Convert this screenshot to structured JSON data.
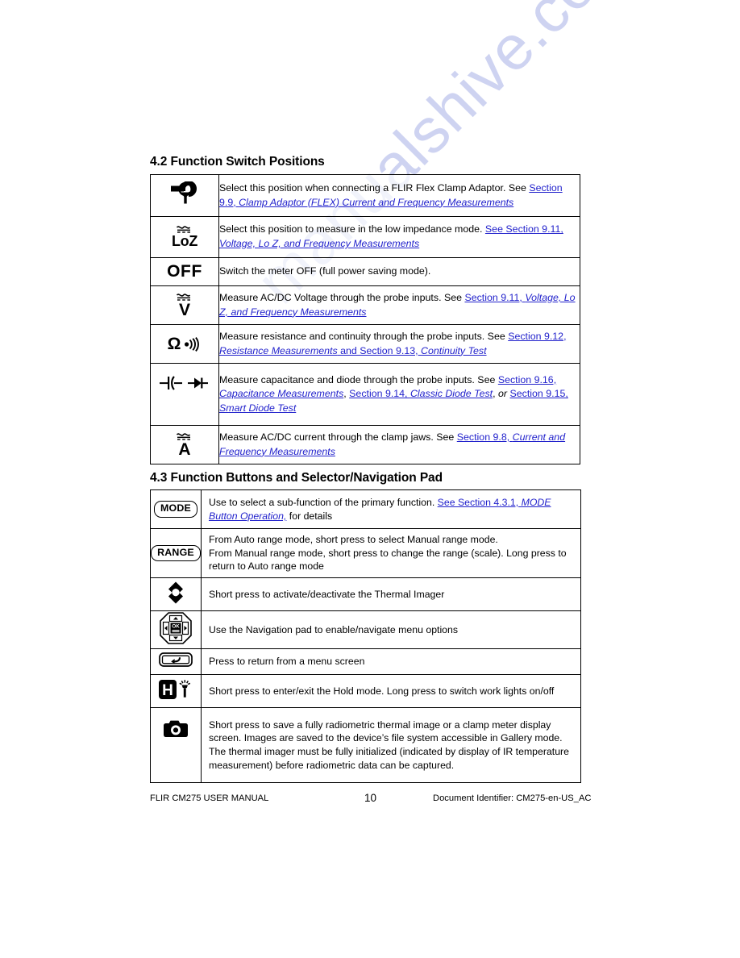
{
  "document": {
    "watermark": "manualshive.com"
  },
  "sections": {
    "switch_positions": {
      "heading": "4.2 Function Switch Positions",
      "rows": [
        {
          "icon": "flex-clamp-adaptor-icon",
          "icon_label": "",
          "text_parts": [
            {
              "t": "Select this position when connecting a FLIR Flex Clamp Adaptor. See ",
              "style": "plain"
            },
            {
              "t": "Section 9.9, ",
              "style": "link"
            },
            {
              "t": "Clamp Adaptor (FLEX) Current and Frequency Measurements",
              "style": "link-italic"
            }
          ]
        },
        {
          "icon": "loz-icon",
          "icon_label": "LoZ",
          "text_parts": [
            {
              "t": "Select this position to measure in the low impedance mode. ",
              "style": "plain"
            },
            {
              "t": "See Section 9.11, ",
              "style": "link"
            },
            {
              "t": "Voltage, Lo Z, and Frequency Measurements",
              "style": "link-italic"
            }
          ]
        },
        {
          "icon": "off-icon",
          "icon_label": "OFF",
          "text_parts": [
            {
              "t": "Switch the meter OFF (full power saving mode).",
              "style": "plain"
            }
          ]
        },
        {
          "icon": "acdc-voltage-icon",
          "icon_label": "V",
          "text_parts": [
            {
              "t": "Measure AC/DC Voltage through the probe inputs. See ",
              "style": "plain"
            },
            {
              "t": "Section 9.11, ",
              "style": "link"
            },
            {
              "t": "Voltage, Lo Z, and Frequency Measurements",
              "style": "link-italic"
            }
          ]
        },
        {
          "icon": "ohm-continuity-icon",
          "icon_label": "Ω",
          "text_parts": [
            {
              "t": "Measure resistance and continuity through the probe inputs. See ",
              "style": "plain"
            },
            {
              "t": "Section 9.12, ",
              "style": "link"
            },
            {
              "t": "Resistance Measurements",
              "style": "link-italic"
            },
            {
              "t": " and Section 9.13, ",
              "style": "link"
            },
            {
              "t": "Continuity Test",
              "style": "link-italic"
            }
          ]
        },
        {
          "icon": "capacitance-diode-icon",
          "icon_label": "",
          "text_parts": [
            {
              "t": "Measure capacitance and diode through the probe inputs.  See ",
              "style": "plain"
            },
            {
              "t": "Section 9.16, ",
              "style": "link"
            },
            {
              "t": "Capacitance Measurements",
              "style": "link-italic"
            },
            {
              "t": ", ",
              "style": "plain"
            },
            {
              "t": "Section 9.14, ",
              "style": "link"
            },
            {
              "t": "Classic Diode Test",
              "style": "link-italic"
            },
            {
              "t": ", ",
              "style": "plain"
            },
            {
              "t": "or ",
              "style": "italic"
            },
            {
              "t": "Section 9.15, ",
              "style": "link"
            },
            {
              "t": "Smart Diode Test",
              "style": "link-italic"
            }
          ]
        },
        {
          "icon": "acdc-current-icon",
          "icon_label": "A",
          "text_parts": [
            {
              "t": "Measure AC/DC current through the clamp jaws. See ",
              "style": "plain"
            },
            {
              "t": "Section 9.8, ",
              "style": "link"
            },
            {
              "t": "Current and Frequency Measurements",
              "style": "link-italic"
            }
          ]
        }
      ]
    },
    "function_buttons": {
      "heading": "4.3 Function Buttons and Selector/Navigation Pad",
      "rows": [
        {
          "icon": "mode-button-icon",
          "icon_label": "MODE",
          "text_parts": [
            {
              "t": "Use to select a sub-function of the primary function. ",
              "style": "plain"
            },
            {
              "t": "See Section 4.3.1, ",
              "style": "link"
            },
            {
              "t": "MODE Button Operation,",
              "style": "link-italic"
            },
            {
              "t": " for details",
              "style": "plain"
            }
          ]
        },
        {
          "icon": "range-button-icon",
          "icon_label": "RANGE",
          "text_parts": [
            {
              "t": "From Auto range mode, short press to select Manual range mode.",
              "style": "plain"
            },
            {
              "t": "<br>",
              "style": "break"
            },
            {
              "t": "From Manual range mode, short press to change the range (scale). Long press to return to Auto range mode",
              "style": "plain"
            }
          ]
        },
        {
          "icon": "thermal-imager-diamond-icon",
          "icon_label": "",
          "text_parts": [
            {
              "t": "Short press to activate/deactivate the Thermal Imager",
              "style": "plain"
            }
          ]
        },
        {
          "icon": "navigation-pad-icon",
          "icon_label": "OK",
          "text_parts": [
            {
              "t": "Use the Navigation pad to enable/navigate menu options",
              "style": "plain"
            }
          ]
        },
        {
          "icon": "return-back-button-icon",
          "icon_label": "",
          "text_parts": [
            {
              "t": "Press to return from a menu screen",
              "style": "plain"
            }
          ]
        },
        {
          "icon": "hold-worklight-icon",
          "icon_label": "H",
          "text_parts": [
            {
              "t": "Short press to enter/exit the Hold mode. Long press to switch work lights on/off",
              "style": "plain"
            }
          ]
        },
        {
          "icon": "camera-icon",
          "icon_label": "",
          "text_parts": [
            {
              "t": "Short press to save a fully radiometric thermal image or a clamp meter display screen. Images are saved to the device’s file system accessible in Gallery mode. The thermal imager must be fully initialized (indicated by display of IR temperature measurement) before radiometric data can be captured.",
              "style": "plain"
            }
          ]
        }
      ]
    }
  },
  "footer": {
    "left": "FLIR CM275 USER MANUAL",
    "page_number": "10",
    "right": "Document Identifier: CM275-en-US_AC"
  },
  "colors": {
    "link": "#2222cc",
    "text": "#000000",
    "watermark": "#c6ccef",
    "border": "#000000"
  }
}
